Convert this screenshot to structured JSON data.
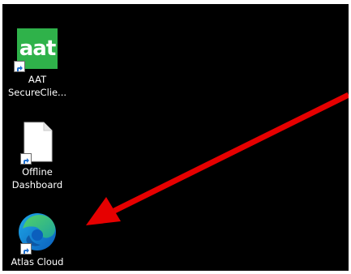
{
  "desktop": {
    "icons": [
      {
        "name": "aat-secureclient",
        "label_line1": "AAT",
        "label_line2": "SecureClie...",
        "tile_text": "aat",
        "icon": "aat-app-icon"
      },
      {
        "name": "offline-dashboard",
        "label_line1": "Offline",
        "label_line2": "Dashboard",
        "icon": "document-icon"
      },
      {
        "name": "atlas-cloud",
        "label_line1": "Atlas Cloud",
        "label_line2": "",
        "icon": "edge-browser-icon"
      }
    ],
    "annotation": {
      "icon": "red-arrow-icon",
      "color": "#e60000"
    }
  },
  "colors": {
    "desktop_bg": "#000000",
    "aat_green": "#2fb24a",
    "arrow_red": "#e60000",
    "label_text": "#ffffff"
  }
}
